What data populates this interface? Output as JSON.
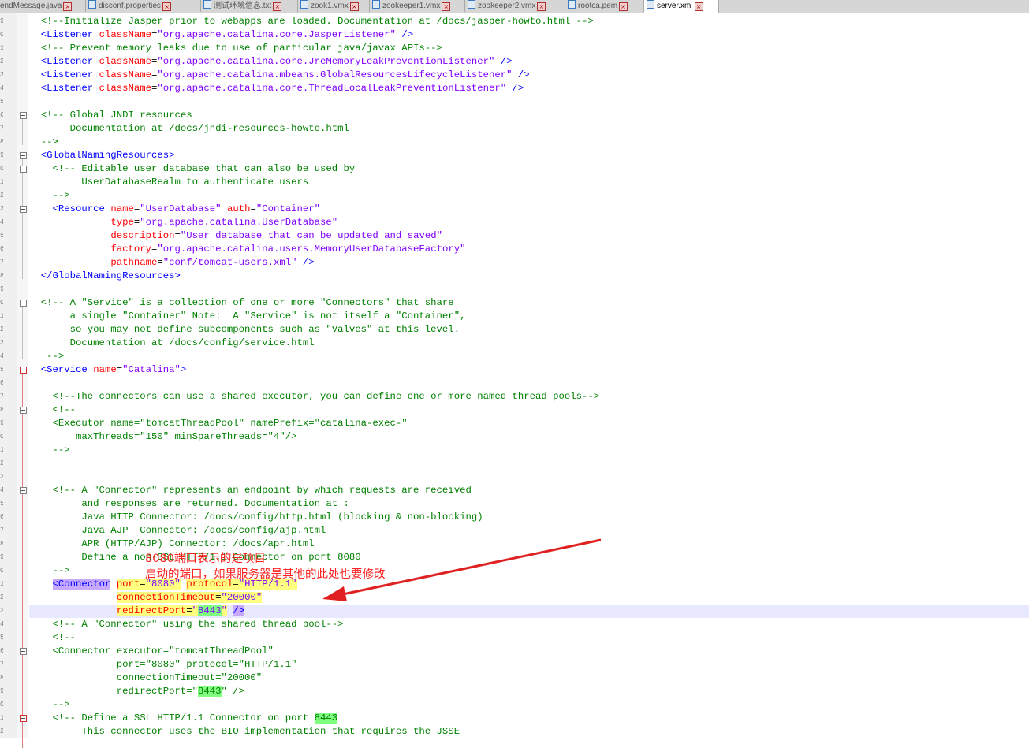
{
  "tabs": [
    {
      "label": "endMessage.java",
      "width": 106
    },
    {
      "label": "disconf.properties",
      "width": 143
    },
    {
      "label": "测试环境信息.txt",
      "width": 120
    },
    {
      "label": "zook1.vmx",
      "width": 88
    },
    {
      "label": "zookeeper1.vmx",
      "width": 118
    },
    {
      "label": "zookeeper2.vmx",
      "width": 124
    },
    {
      "label": "rootca.pem",
      "width": 97
    },
    {
      "label": "server.xml",
      "width": 92,
      "active": true
    }
  ],
  "line_number_hints": [
    "9",
    "0",
    "1",
    "2",
    "3",
    "4",
    "5",
    "6",
    "7",
    "8",
    "9",
    "0",
    "1",
    "2",
    "3",
    "4",
    "5",
    "6",
    "7",
    "8",
    "9",
    "0",
    "1",
    "2",
    "3",
    "4",
    "5",
    "6",
    "7",
    "8",
    "9",
    "0",
    "1",
    "2",
    "3",
    "4",
    "5",
    "6",
    "7",
    "8",
    "9",
    "0",
    "1",
    "2",
    "3",
    "4",
    "5",
    "6",
    "7",
    "8",
    "9",
    "0",
    "1",
    "2",
    "3",
    "4",
    "5"
  ],
  "lines": [
    [
      [
        "cm",
        "  <!--Initialize Jasper prior to webapps are loaded. Documentation at /docs/jasper-howto.html -->"
      ]
    ],
    [
      [
        "tg",
        "  <Listener "
      ],
      [
        "at",
        "className"
      ],
      [
        "tx",
        "="
      ],
      [
        "av",
        "\"org.apache.catalina.core.JasperListener\""
      ],
      [
        "tg",
        " />"
      ]
    ],
    [
      [
        "cm",
        "  <!-- Prevent memory leaks due to use of particular java/javax APIs-->"
      ]
    ],
    [
      [
        "tg",
        "  <Listener "
      ],
      [
        "at",
        "className"
      ],
      [
        "tx",
        "="
      ],
      [
        "av",
        "\"org.apache.catalina.core.JreMemoryLeakPreventionListener\""
      ],
      [
        "tg",
        " />"
      ]
    ],
    [
      [
        "tg",
        "  <Listener "
      ],
      [
        "at",
        "className"
      ],
      [
        "tx",
        "="
      ],
      [
        "av",
        "\"org.apache.catalina.mbeans.GlobalResourcesLifecycleListener\""
      ],
      [
        "tg",
        " />"
      ]
    ],
    [
      [
        "tg",
        "  <Listener "
      ],
      [
        "at",
        "className"
      ],
      [
        "tx",
        "="
      ],
      [
        "av",
        "\"org.apache.catalina.core.ThreadLocalLeakPreventionListener\""
      ],
      [
        "tg",
        " />"
      ]
    ],
    [],
    [
      [
        "cm",
        "  <!-- Global JNDI resources"
      ]
    ],
    [
      [
        "cm",
        "       Documentation at /docs/jndi-resources-howto.html"
      ]
    ],
    [
      [
        "cm",
        "  -->"
      ]
    ],
    [
      [
        "tg",
        "  <GlobalNamingResources>"
      ]
    ],
    [
      [
        "cm",
        "    <!-- Editable user database that can also be used by"
      ]
    ],
    [
      [
        "cm",
        "         UserDatabaseRealm to authenticate users"
      ]
    ],
    [
      [
        "cm",
        "    -->"
      ]
    ],
    [
      [
        "tg",
        "    <Resource "
      ],
      [
        "at",
        "name"
      ],
      [
        "tx",
        "="
      ],
      [
        "av",
        "\"UserDatabase\""
      ],
      [
        "tx",
        " "
      ],
      [
        "at",
        "auth"
      ],
      [
        "tx",
        "="
      ],
      [
        "av",
        "\"Container\""
      ]
    ],
    [
      [
        "tx",
        "              "
      ],
      [
        "at",
        "type"
      ],
      [
        "tx",
        "="
      ],
      [
        "av",
        "\"org.apache.catalina.UserDatabase\""
      ]
    ],
    [
      [
        "tx",
        "              "
      ],
      [
        "at",
        "description"
      ],
      [
        "tx",
        "="
      ],
      [
        "av",
        "\"User database that can be updated and saved\""
      ]
    ],
    [
      [
        "tx",
        "              "
      ],
      [
        "at",
        "factory"
      ],
      [
        "tx",
        "="
      ],
      [
        "av",
        "\"org.apache.catalina.users.MemoryUserDatabaseFactory\""
      ]
    ],
    [
      [
        "tx",
        "              "
      ],
      [
        "at",
        "pathname"
      ],
      [
        "tx",
        "="
      ],
      [
        "av",
        "\"conf/tomcat-users.xml\""
      ],
      [
        "tg",
        " />"
      ]
    ],
    [
      [
        "tg",
        "  </GlobalNamingResources>"
      ]
    ],
    [],
    [
      [
        "cm",
        "  <!-- A \"Service\" is a collection of one or more \"Connectors\" that share"
      ]
    ],
    [
      [
        "cm",
        "       a single \"Container\" Note:  A \"Service\" is not itself a \"Container\","
      ]
    ],
    [
      [
        "cm",
        "       so you may not define subcomponents such as \"Valves\" at this level."
      ]
    ],
    [
      [
        "cm",
        "       Documentation at /docs/config/service.html"
      ]
    ],
    [
      [
        "cm",
        "   -->"
      ]
    ],
    [
      [
        "tg",
        "  <Service "
      ],
      [
        "at",
        "name"
      ],
      [
        "tx",
        "="
      ],
      [
        "av",
        "\"Catalina\""
      ],
      [
        "tg",
        ">"
      ]
    ],
    [],
    [
      [
        "cm",
        "    <!--The connectors can use a shared executor, you can define one or more named thread pools-->"
      ]
    ],
    [
      [
        "cm",
        "    <!--"
      ]
    ],
    [
      [
        "cm",
        "    <Executor name=\"tomcatThreadPool\" namePrefix=\"catalina-exec-\""
      ]
    ],
    [
      [
        "cm",
        "        maxThreads=\"150\" minSpareThreads=\"4\"/>"
      ]
    ],
    [
      [
        "cm",
        "    -->"
      ]
    ],
    [],
    [],
    [
      [
        "cm",
        "    <!-- A \"Connector\" represents an endpoint by which requests are received"
      ]
    ],
    [
      [
        "cm",
        "         and responses are returned. Documentation at :"
      ]
    ],
    [
      [
        "cm",
        "         Java HTTP Connector: /docs/config/http.html (blocking & non-blocking)"
      ]
    ],
    [
      [
        "cm",
        "         Java AJP  Connector: /docs/config/ajp.html"
      ]
    ],
    [
      [
        "cm",
        "         APR (HTTP/AJP) Connector: /docs/apr.html"
      ]
    ],
    [
      [
        "cm",
        "         Define a non-SSL HTTP/1.1 Connector on port 8080"
      ]
    ],
    [
      [
        "cm",
        "    -->"
      ]
    ],
    [
      [
        "tx",
        "    "
      ],
      [
        "tg hp",
        "<Connector"
      ],
      [
        "tx",
        " "
      ],
      [
        "at hy",
        "port"
      ],
      [
        "tx hy",
        "="
      ],
      [
        "av hy",
        "\"8080\""
      ],
      [
        "tx",
        " "
      ],
      [
        "at hy",
        "protocol"
      ],
      [
        "tx hy",
        "="
      ],
      [
        "av hy",
        "\"HTTP/1.1\""
      ]
    ],
    [
      [
        "tx",
        "               "
      ],
      [
        "at hy",
        "connectionTimeout"
      ],
      [
        "tx hy",
        "="
      ],
      [
        "av hy",
        "\"20000\""
      ]
    ],
    [
      [
        "tx",
        "               "
      ],
      [
        "at hy",
        "redirectPort"
      ],
      [
        "tx hy",
        "="
      ],
      [
        "av hy",
        "\""
      ],
      [
        "av hg",
        "8443"
      ],
      [
        "av hy",
        "\""
      ],
      [
        "tx",
        " "
      ],
      [
        "tg hp",
        "/>"
      ]
    ],
    [
      [
        "cm",
        "    <!-- A \"Connector\" using the shared thread pool-->"
      ]
    ],
    [
      [
        "cm",
        "    <!--"
      ]
    ],
    [
      [
        "cm",
        "    <Connector executor=\"tomcatThreadPool\""
      ]
    ],
    [
      [
        "cm",
        "               port=\"8080\" protocol=\"HTTP/1.1\""
      ]
    ],
    [
      [
        "cm",
        "               connectionTimeout=\"20000\""
      ]
    ],
    [
      [
        "cm",
        "               redirectPort=\""
      ],
      [
        "cm hg",
        "8443"
      ],
      [
        "cm",
        "\" />"
      ]
    ],
    [
      [
        "cm",
        "    -->"
      ]
    ],
    [
      [
        "cm",
        "    <!-- Define a SSL HTTP/1.1 Connector on port "
      ],
      [
        "cm hg",
        "8443"
      ]
    ],
    [
      [
        "cm",
        "         This connector uses the BIO implementation that requires the JSSE"
      ]
    ]
  ],
  "annotation": {
    "line1": "8080端口表示的是项目",
    "line2": "启动的端口，如果服务器是其他的此处也要修改",
    "color": "#ff2020"
  }
}
